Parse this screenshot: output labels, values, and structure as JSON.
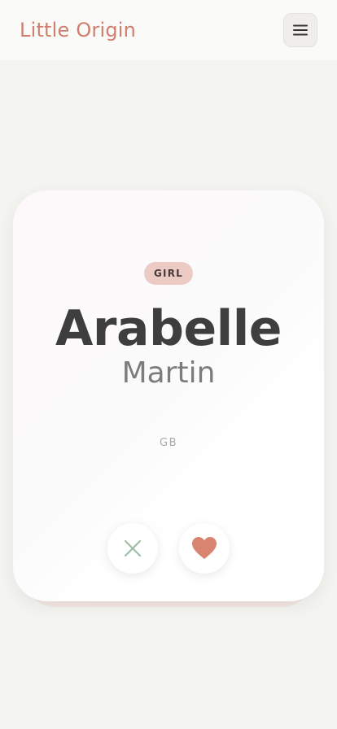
{
  "header": {
    "brand": "Little Origin",
    "menu_icon": "hamburger-menu-icon"
  },
  "card": {
    "gender": "GIRL",
    "first_name": "Arabelle",
    "last_name": "Martin",
    "country": "GB"
  },
  "actions": {
    "reject_icon": "close-icon",
    "like_icon": "heart-icon"
  },
  "colors": {
    "brand": "#d07f6d",
    "background": "#f4f4f1",
    "badge_bg": "#eccbc5",
    "reject_icon": "#9fbea4",
    "heart_icon": "#d88470",
    "name_text": "#3e3e3e"
  }
}
